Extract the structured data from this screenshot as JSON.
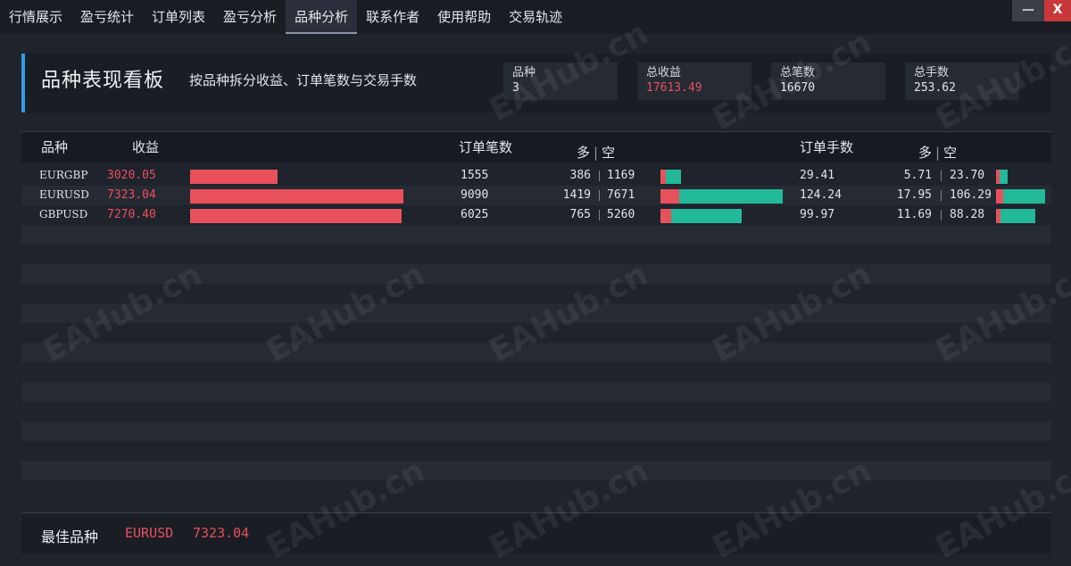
{
  "nav": {
    "tabs": [
      {
        "label": "行情展示",
        "active": false
      },
      {
        "label": "盈亏统计",
        "active": false
      },
      {
        "label": "订单列表",
        "active": false
      },
      {
        "label": "盈亏分析",
        "active": false
      },
      {
        "label": "品种分析",
        "active": true
      },
      {
        "label": "联系作者",
        "active": false
      },
      {
        "label": "使用帮助",
        "active": false
      },
      {
        "label": "交易轨迹",
        "active": false
      }
    ],
    "minimize_label": "—",
    "close_label": "X"
  },
  "header": {
    "title": "品种表现看板",
    "subtitle": "按品种拆分收益、订单笔数与交易手数",
    "stats": [
      {
        "label": "品种",
        "value": "3"
      },
      {
        "label": "总收益",
        "value": "17613.49"
      },
      {
        "label": "总笔数",
        "value": "16670"
      },
      {
        "label": "总手数",
        "value": "253.62"
      }
    ]
  },
  "table": {
    "headers": {
      "symbol": "品种",
      "profit": "收益",
      "orders": "订单笔数",
      "long": "多",
      "short": "空",
      "lots": "订单手数"
    },
    "rows": [
      {
        "symbol": "EURGBP",
        "profit": "3020.05",
        "profit_frac": 0.412,
        "orders": "1555",
        "orders_long": "386",
        "orders_short": "1169",
        "lots": "29.41",
        "lots_long": "5.71",
        "lots_short": "23.70"
      },
      {
        "symbol": "EURUSD",
        "profit": "7323.04",
        "profit_frac": 1.0,
        "orders": "9090",
        "orders_long": "1419",
        "orders_short": "7671",
        "lots": "124.24",
        "lots_long": "17.95",
        "lots_short": "106.29"
      },
      {
        "symbol": "GBPUSD",
        "profit": "7270.40",
        "profit_frac": 0.993,
        "orders": "6025",
        "orders_long": "765",
        "orders_short": "5260",
        "lots": "99.97",
        "lots_long": "11.69",
        "lots_short": "88.28"
      }
    ]
  },
  "footer": {
    "label": "最佳品种",
    "symbol": "EURUSD",
    "value": "7323.04"
  },
  "watermark": "EAHub.cn",
  "colors": {
    "profit": "#e8505b",
    "short": "#22b999",
    "accent": "#2f9ee6"
  }
}
